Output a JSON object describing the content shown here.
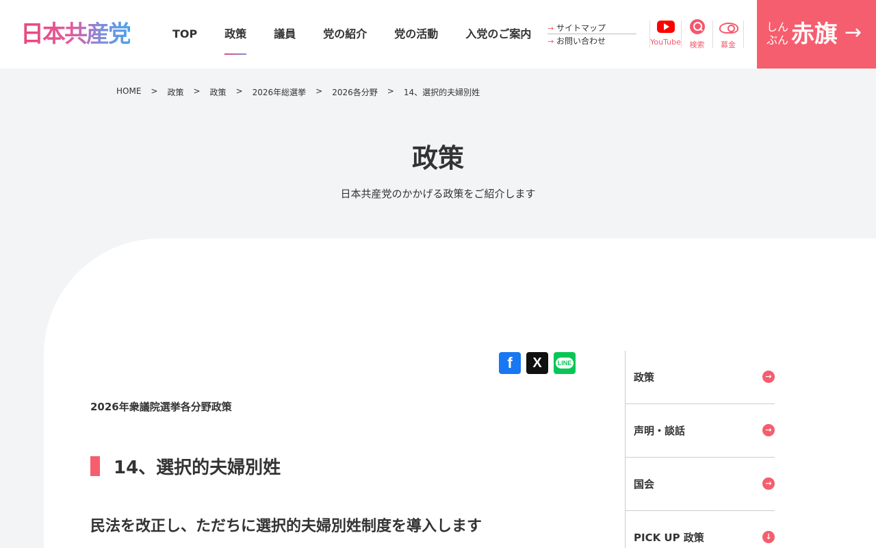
{
  "header": {
    "logo_text": "日本共産党",
    "nav": [
      "TOP",
      "政策",
      "議員",
      "党の紹介",
      "党の活動",
      "入党のご案内"
    ],
    "active_nav": "政策",
    "sub_links": [
      "サイトマップ",
      "お問い合わせ"
    ],
    "youtube_label": "YouTube",
    "search_label": "検索",
    "fund_label": "募金",
    "akahata_small": "しんぶん",
    "akahata_big": "赤旗",
    "akahata_arrow": "→"
  },
  "breadcrumb": [
    "HOME",
    "政策",
    "政策",
    "2026年総選挙",
    "2026各分野",
    "14、選択的夫婦別姓"
  ],
  "breadcrumb_sep": ">",
  "page": {
    "title": "政策",
    "subtitle": "日本共産党のかかげる政策をご紹介します"
  },
  "share": {
    "facebook": "f",
    "x": "X",
    "line": "LINE"
  },
  "article": {
    "kicker": "2026年衆議院選挙各分野政策",
    "heading": "14、選択的夫婦別姓",
    "subheading": "民法を改正し、ただちに選択的夫婦別姓制度を導入します"
  },
  "side_nav": [
    {
      "label": "政策",
      "icon": "→"
    },
    {
      "label": "声明・談話",
      "icon": "→"
    },
    {
      "label": "国会",
      "icon": "→"
    },
    {
      "label": "PICK UP 政策",
      "icon": "↓"
    }
  ],
  "colors": {
    "accent": "#f55e6e",
    "bg": "#f3f4f6"
  }
}
